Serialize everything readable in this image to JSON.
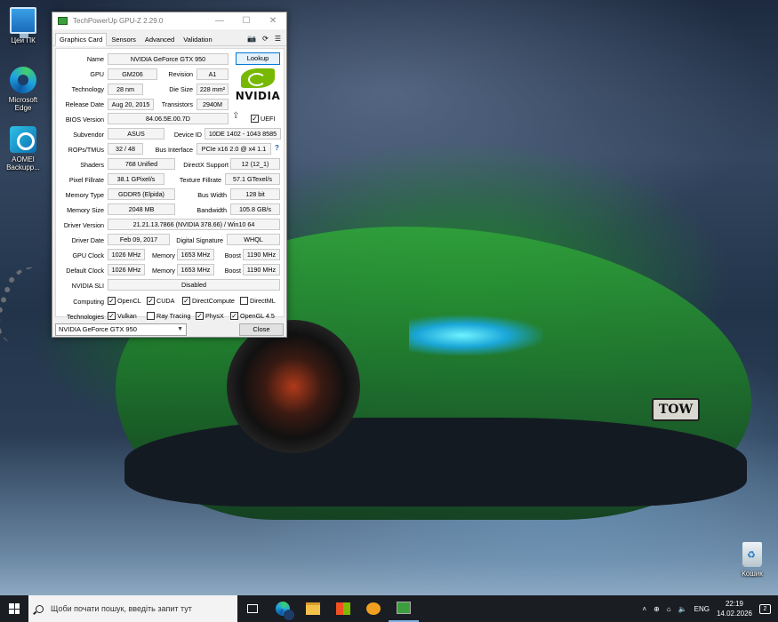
{
  "desktop": {
    "icons": [
      {
        "label": "Цей ПК",
        "icon": "this-pc-icon"
      },
      {
        "label": "Microsoft Edge",
        "icon": "edge-icon"
      },
      {
        "label": "AOMEI Backupp...",
        "icon": "aomei-backupper-icon"
      },
      {
        "label": "Кошик",
        "icon": "recycle-bin-icon"
      }
    ],
    "wallpaper_plate_text": "TOW"
  },
  "window": {
    "title": "TechPowerUp GPU-Z 2.29.0",
    "tabs": [
      "Graphics Card",
      "Sensors",
      "Advanced",
      "Validation"
    ],
    "active_tab": "Graphics Card",
    "toolbar_icons": [
      "camera-icon",
      "refresh-icon",
      "menu-icon"
    ],
    "lookup_label": "Lookup",
    "vendor_logo_text": "NVIDIA",
    "fields": {
      "name": {
        "label": "Name",
        "value": "NVIDIA GeForce GTX 950"
      },
      "gpu": {
        "label": "GPU",
        "value": "GM206"
      },
      "revision": {
        "label": "Revision",
        "value": "A1"
      },
      "technology": {
        "label": "Technology",
        "value": "28 nm"
      },
      "die_size": {
        "label": "Die Size",
        "value": "228 mm²"
      },
      "release_date": {
        "label": "Release Date",
        "value": "Aug 20, 2015"
      },
      "transistors": {
        "label": "Transistors",
        "value": "2940M"
      },
      "bios_version": {
        "label": "BIOS Version",
        "value": "84.06.5E.00.7D"
      },
      "uefi": {
        "label": "UEFI",
        "checked": true
      },
      "subvendor": {
        "label": "Subvendor",
        "value": "ASUS"
      },
      "device_id": {
        "label": "Device ID",
        "value": "10DE 1402 - 1043 8585"
      },
      "rops_tmus": {
        "label": "ROPs/TMUs",
        "value": "32 / 48"
      },
      "bus_interface": {
        "label": "Bus Interface",
        "value": "PCIe x16 2.0 @ x4 1.1"
      },
      "shaders": {
        "label": "Shaders",
        "value": "768 Unified"
      },
      "directx": {
        "label": "DirectX Support",
        "value": "12 (12_1)"
      },
      "pixel_fillrate": {
        "label": "Pixel Fillrate",
        "value": "38.1 GPixel/s"
      },
      "texture_fillrate": {
        "label": "Texture Fillrate",
        "value": "57.1 GTexel/s"
      },
      "memory_type": {
        "label": "Memory Type",
        "value": "GDDR5 (Elpida)"
      },
      "bus_width": {
        "label": "Bus Width",
        "value": "128 bit"
      },
      "memory_size": {
        "label": "Memory Size",
        "value": "2048 MB"
      },
      "bandwidth": {
        "label": "Bandwidth",
        "value": "105.8 GB/s"
      },
      "driver_version": {
        "label": "Driver Version",
        "value": "21.21.13.7866 (NVIDIA 378.66) / Win10 64"
      },
      "driver_date": {
        "label": "Driver Date",
        "value": "Feb 09, 2017"
      },
      "digital_signature": {
        "label": "Digital Signature",
        "value": "WHQL"
      },
      "gpu_clock": {
        "label": "GPU Clock",
        "value": "1026 MHz",
        "memory_label": "Memory",
        "memory": "1653 MHz",
        "boost_label": "Boost",
        "boost": "1190 MHz"
      },
      "default_clock": {
        "label": "Default Clock",
        "value": "1026 MHz",
        "memory_label": "Memory",
        "memory": "1653 MHz",
        "boost_label": "Boost",
        "boost": "1190 MHz"
      },
      "nvidia_sli": {
        "label": "NVIDIA SLI",
        "value": "Disabled"
      }
    },
    "computing": {
      "label": "Computing",
      "items": [
        {
          "label": "OpenCL",
          "checked": true
        },
        {
          "label": "CUDA",
          "checked": true
        },
        {
          "label": "DirectCompute",
          "checked": true
        },
        {
          "label": "DirectML",
          "checked": false
        }
      ]
    },
    "technologies": {
      "label": "Technologies",
      "items": [
        {
          "label": "Vulkan",
          "checked": true
        },
        {
          "label": "Ray Tracing",
          "checked": false
        },
        {
          "label": "PhysX",
          "checked": true
        },
        {
          "label": "OpenGL 4.5",
          "checked": true
        }
      ]
    },
    "gpu_select": "NVIDIA GeForce GTX 950",
    "close_label": "Close"
  },
  "taskbar": {
    "search_placeholder": "Щоби почати пошук, введіть запит тут",
    "apps": [
      "task-view-icon",
      "edge-icon",
      "file-explorer-icon",
      "store-icon",
      "browser-icon",
      "gpu-z-icon"
    ],
    "language": "ENG",
    "time": "22:19",
    "date": "14.02.2026",
    "notifications": "2"
  },
  "colors": {
    "nvidia_green": "#76b900",
    "taskbar": "#1a1d22",
    "lookup_border": "#0078d7"
  }
}
